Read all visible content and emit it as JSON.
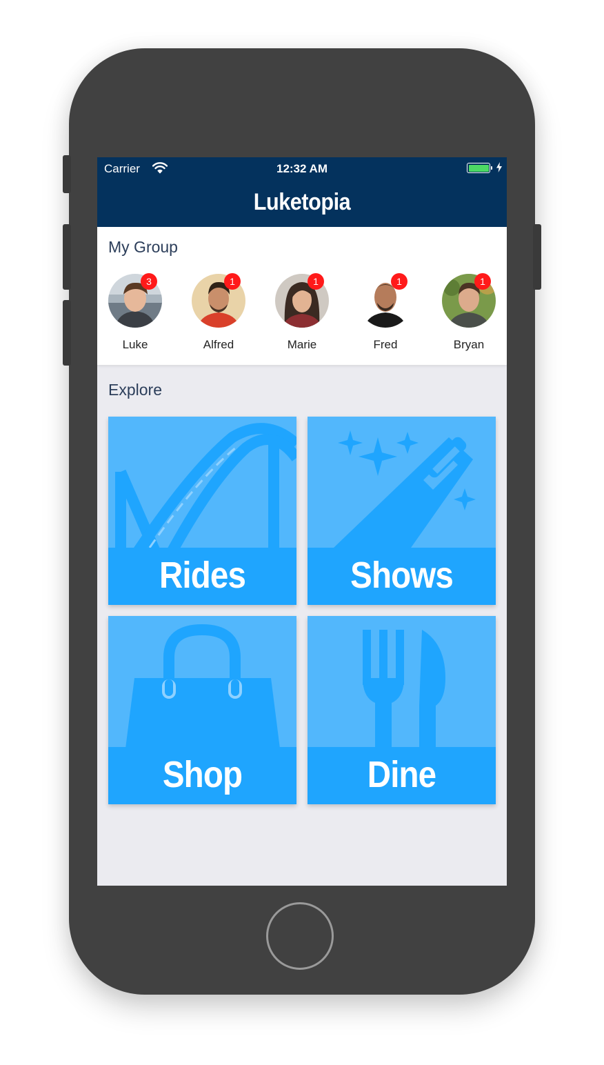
{
  "status_bar": {
    "carrier": "Carrier",
    "time": "12:32 AM",
    "battery_level": 1.0
  },
  "nav": {
    "title": "Luketopia"
  },
  "group": {
    "title": "My Group",
    "members": [
      {
        "name": "Luke",
        "badge": "3"
      },
      {
        "name": "Alfred",
        "badge": "1"
      },
      {
        "name": "Marie",
        "badge": "1"
      },
      {
        "name": "Fred",
        "badge": "1"
      },
      {
        "name": "Bryan",
        "badge": "1"
      }
    ]
  },
  "explore": {
    "title": "Explore",
    "tiles": [
      {
        "label": "Rides",
        "icon": "roller-coaster-icon"
      },
      {
        "label": "Shows",
        "icon": "magic-wand-icon"
      },
      {
        "label": "Shop",
        "icon": "shopping-bag-icon"
      },
      {
        "label": "Dine",
        "icon": "fork-knife-icon"
      }
    ]
  },
  "colors": {
    "nav_background": "#04325d",
    "tile_background": "#52b7fc",
    "tile_band": "#1fa5fe",
    "badge": "#ff1a1a"
  }
}
